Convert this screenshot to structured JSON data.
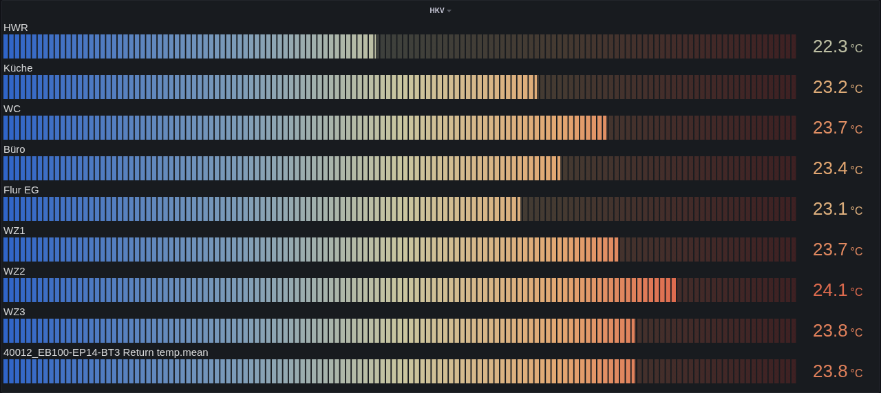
{
  "panel": {
    "title": "HKV"
  },
  "gauges": [
    {
      "name": "HWR",
      "level": 0.47,
      "value": "22.3",
      "unit": "°C"
    },
    {
      "name": "Küche",
      "level": 0.673,
      "value": "23.2",
      "unit": "°C"
    },
    {
      "name": "WC",
      "level": 0.76,
      "value": "23.7",
      "unit": "°C"
    },
    {
      "name": "Büro",
      "level": 0.702,
      "value": "23.4",
      "unit": "°C"
    },
    {
      "name": "Flur EG",
      "level": 0.652,
      "value": "23.1",
      "unit": "°C"
    },
    {
      "name": "WZ1",
      "level": 0.775,
      "value": "23.7",
      "unit": "°C"
    },
    {
      "name": "WZ2",
      "level": 0.848,
      "value": "24.1",
      "unit": "°C"
    },
    {
      "name": "WZ3",
      "level": 0.796,
      "value": "23.8",
      "unit": "°C"
    },
    {
      "name": "40012_EB100-EP14-BT3 Return temp.mean",
      "level": 0.796,
      "value": "23.8",
      "unit": "°C"
    }
  ]
}
